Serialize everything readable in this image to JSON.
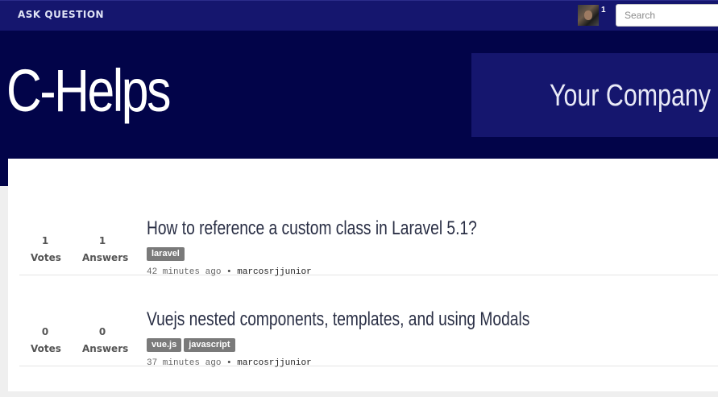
{
  "nav": {
    "ask_label": "ASK QUESTION",
    "notification_count": "1",
    "search_placeholder": "Search"
  },
  "hero": {
    "brand": "C-Helps",
    "company": "Your Company"
  },
  "questions": [
    {
      "votes": "1",
      "votes_label": "Votes",
      "answers": "1",
      "answers_label": "Answers",
      "title": "How to reference a custom class in Laravel 5.1?",
      "tags": [
        "laravel"
      ],
      "time": "42 minutes ago",
      "separator": "•",
      "user": "marcosrjjunior"
    },
    {
      "votes": "0",
      "votes_label": "Votes",
      "answers": "0",
      "answers_label": "Answers",
      "title": "Vuejs nested components, templates, and using Modals",
      "tags": [
        "vue.js",
        "javascript"
      ],
      "time": "37 minutes ago",
      "separator": "•",
      "user": "marcosrjjunior"
    }
  ]
}
